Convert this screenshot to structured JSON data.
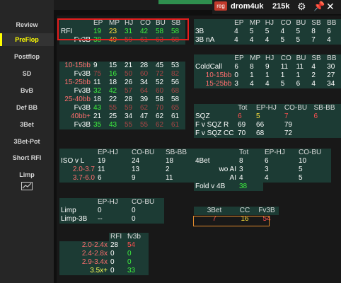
{
  "sidebar": {
    "items": [
      {
        "label": "Review"
      },
      {
        "label": "PreFlop",
        "active": true
      },
      {
        "label": "Postflop"
      },
      {
        "label": "SD"
      },
      {
        "label": "BvB"
      },
      {
        "label": "Def BB"
      },
      {
        "label": "3Bet"
      },
      {
        "label": "3Bet-Pot"
      },
      {
        "label": "Short RFI"
      },
      {
        "label": "Limp"
      }
    ],
    "chart_icon": "chart-icon"
  },
  "topbar": {
    "badge": "reg",
    "username": "drom4uk",
    "hands": "215k",
    "icons": [
      "gear-icon",
      "pin-icon",
      "close-icon"
    ]
  },
  "tables": {
    "rfi": {
      "headers": [
        "",
        "EP",
        "MP",
        "HJ",
        "CO",
        "BU",
        "SB"
      ],
      "rows": [
        {
          "label": "RFI",
          "cells": [
            [
              "19",
              "g"
            ],
            [
              "23",
              "y"
            ],
            [
              "31",
              "g"
            ],
            [
              "42",
              "g"
            ],
            [
              "58",
              "g"
            ],
            [
              "58",
              "g"
            ]
          ]
        },
        {
          "label": "Fv3B",
          "cells": [
            [
              "38",
              "g"
            ],
            [
              "49",
              "o"
            ],
            [
              "59",
              "dr"
            ],
            [
              "61",
              "dr"
            ],
            [
              "63",
              "dr"
            ],
            [
              "68",
              "dr"
            ]
          ]
        },
        {
          "label": "",
          "cells": []
        },
        {
          "label": "",
          "cells": []
        },
        {
          "label": "10-15bb",
          "cells": [
            [
              "9",
              "w"
            ],
            [
              "15",
              "w"
            ],
            [
              "21",
              "w"
            ],
            [
              "28",
              "w"
            ],
            [
              "45",
              "w"
            ],
            [
              "53",
              "w"
            ]
          ]
        },
        {
          "label": "Fv3B",
          "cells": [
            [
              "75",
              "dr"
            ],
            [
              "16",
              "g"
            ],
            [
              "50",
              "dr"
            ],
            [
              "60",
              "dr"
            ],
            [
              "72",
              "dr"
            ],
            [
              "82",
              "dr"
            ]
          ]
        },
        {
          "label": "15-25bb",
          "cells": [
            [
              "11",
              "w"
            ],
            [
              "18",
              "w"
            ],
            [
              "26",
              "w"
            ],
            [
              "34",
              "w"
            ],
            [
              "52",
              "w"
            ],
            [
              "56",
              "w"
            ]
          ]
        },
        {
          "label": "Fv3B",
          "cells": [
            [
              "32",
              "g"
            ],
            [
              "42",
              "g"
            ],
            [
              "57",
              "dr"
            ],
            [
              "64",
              "dr"
            ],
            [
              "60",
              "dr"
            ],
            [
              "68",
              "dr"
            ]
          ]
        },
        {
          "label": "25-40bb",
          "cells": [
            [
              "18",
              "w"
            ],
            [
              "22",
              "w"
            ],
            [
              "28",
              "w"
            ],
            [
              "39",
              "w"
            ],
            [
              "58",
              "w"
            ],
            [
              "58",
              "w"
            ]
          ]
        },
        {
          "label": "Fv3B",
          "cells": [
            [
              "43",
              "g"
            ],
            [
              "55",
              "dr"
            ],
            [
              "59",
              "dr"
            ],
            [
              "62",
              "dr"
            ],
            [
              "70",
              "dr"
            ],
            [
              "65",
              "dr"
            ]
          ]
        },
        {
          "label": "40bb+",
          "cells": [
            [
              "21",
              "w"
            ],
            [
              "25",
              "w"
            ],
            [
              "34",
              "w"
            ],
            [
              "47",
              "w"
            ],
            [
              "62",
              "w"
            ],
            [
              "61",
              "w"
            ]
          ]
        },
        {
          "label": "Fv3B",
          "cells": [
            [
              "35",
              "g"
            ],
            [
              "43",
              "g"
            ],
            [
              "55",
              "dr"
            ],
            [
              "55",
              "dr"
            ],
            [
              "62",
              "dr"
            ],
            [
              "61",
              "dr"
            ]
          ]
        }
      ]
    },
    "threebet": {
      "headers": [
        "",
        "EP",
        "MP",
        "HJ",
        "CO",
        "BU",
        "SB",
        "BB"
      ],
      "rows": [
        {
          "label": "3B",
          "cells": [
            "4",
            "5",
            "5",
            "4",
            "5",
            "8",
            "6"
          ]
        },
        {
          "label": "3B nA",
          "cells": [
            "4",
            "4",
            "4",
            "5",
            "5",
            "7",
            "4"
          ]
        }
      ]
    },
    "coldcall": {
      "headers": [
        "",
        "EP",
        "MP",
        "HJ",
        "CO",
        "BU",
        "SB",
        "BB"
      ],
      "rows": [
        {
          "label": "ColdCall",
          "cells": [
            "6",
            "8",
            "9",
            "11",
            "11",
            "4",
            "30"
          ]
        },
        {
          "label": "10-15bb",
          "cells": [
            "0",
            "1",
            "1",
            "1",
            "1",
            "2",
            "27"
          ]
        },
        {
          "label": "15-25bb",
          "cells": [
            "3",
            "4",
            "4",
            "5",
            "6",
            "4",
            "34"
          ]
        }
      ]
    },
    "sqz": {
      "headers": [
        "",
        "Tot",
        "EP-HJ",
        "CO-BU",
        "SB-BB"
      ],
      "rows": [
        {
          "label": "SQZ",
          "cells": [
            [
              "6",
              "r"
            ],
            [
              "5",
              "y"
            ],
            [
              "7",
              "r"
            ],
            [
              "6",
              "r"
            ]
          ]
        },
        {
          "label": "F v SQZ R",
          "cells": [
            [
              "69",
              "w"
            ],
            [
              "66",
              "w"
            ],
            [
              "79",
              "w"
            ],
            [
              "",
              "w"
            ]
          ]
        },
        {
          "label": "F v SQZ CC",
          "cells": [
            [
              "70",
              "w"
            ],
            [
              "68",
              "w"
            ],
            [
              "72",
              "w"
            ],
            [
              "",
              "w"
            ]
          ]
        }
      ]
    },
    "iso": {
      "headers": [
        "",
        "EP-HJ",
        "CO-BU",
        "SB-BB"
      ],
      "rows": [
        {
          "label": "ISO v L",
          "cells": [
            "19",
            "24",
            "18"
          ]
        },
        {
          "label": "2.0-3.7",
          "cells": [
            "11",
            "13",
            "2"
          ]
        },
        {
          "label": "3.7-6.0",
          "cells": [
            "6",
            "9",
            "11"
          ]
        }
      ]
    },
    "fourbet": {
      "headers": [
        "",
        "Tot",
        "EP-HJ",
        "CO-BU"
      ],
      "rows": [
        {
          "label": "4Bet",
          "cells": [
            [
              "8",
              "w"
            ],
            [
              "6",
              "w"
            ],
            [
              "10",
              "w"
            ]
          ]
        },
        {
          "label": "wo AI",
          "cells": [
            [
              "3",
              "w"
            ],
            [
              "3",
              "w"
            ],
            [
              "5",
              "w"
            ]
          ]
        },
        {
          "label": "AI",
          "cells": [
            [
              "4",
              "w"
            ],
            [
              "4",
              "w"
            ],
            [
              "5",
              "w"
            ]
          ]
        },
        {
          "label": "Fold v 4B",
          "cells": [
            [
              "38",
              "g"
            ],
            [
              "",
              ""
            ],
            [
              "",
              ""
            ]
          ]
        }
      ]
    },
    "limp": {
      "headers": [
        "",
        "EP-HJ",
        "CO-BU"
      ],
      "rows": [
        {
          "label": "Limp",
          "cells": [
            "0",
            "0"
          ]
        },
        {
          "label": "Limp-3B",
          "cells": [
            "--",
            "0"
          ]
        }
      ]
    },
    "threebet_summary": {
      "headers": [
        "3Bet",
        "CC",
        "Fv3B"
      ],
      "values": [
        "7",
        "16",
        "54"
      ]
    },
    "sizing": {
      "headers": [
        "",
        "RFI",
        "fv3b"
      ],
      "rows": [
        {
          "label": "2.0-2.4x",
          "cells": [
            [
              "28",
              "w"
            ],
            [
              "54",
              "r"
            ]
          ]
        },
        {
          "label": "2.4-2.8x",
          "cells": [
            [
              "0",
              "w"
            ],
            [
              "0",
              "g"
            ]
          ]
        },
        {
          "label": "2.9-3.4x",
          "cells": [
            [
              "0",
              "w"
            ],
            [
              "0",
              "g"
            ]
          ]
        },
        {
          "label": "3.5x+",
          "cells": [
            [
              "0",
              "w"
            ],
            [
              "33",
              "g"
            ]
          ]
        }
      ]
    }
  },
  "colors": {
    "green": "#3ef03e",
    "yellow": "#ffe33d",
    "orange": "#ff9f2e",
    "red": "#ff5050",
    "teal_bg": "#1c3b34",
    "highlight_box": "#e51e1e"
  }
}
